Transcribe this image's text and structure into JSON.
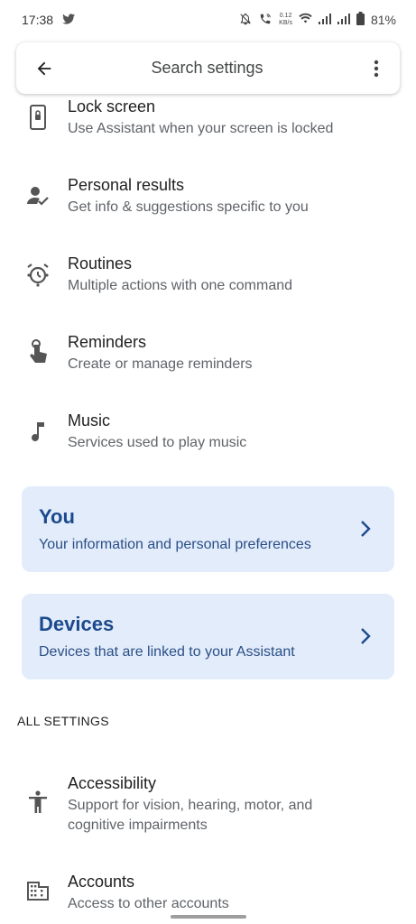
{
  "status_bar": {
    "time": "17:38",
    "net_speed_value": "0.12",
    "net_speed_unit": "KB/s",
    "battery": "81%"
  },
  "search": {
    "placeholder": "Search settings"
  },
  "items": [
    {
      "title": "Lock screen",
      "subtitle": "Use Assistant when your screen is locked"
    },
    {
      "title": "Personal results",
      "subtitle": "Get info & suggestions specific to you"
    },
    {
      "title": "Routines",
      "subtitle": "Multiple actions with one command"
    },
    {
      "title": "Reminders",
      "subtitle": "Create or manage reminders"
    },
    {
      "title": "Music",
      "subtitle": "Services used to play music"
    }
  ],
  "cards": [
    {
      "title": "You",
      "subtitle": "Your information and personal preferences"
    },
    {
      "title": "Devices",
      "subtitle": "Devices that are linked to your Assistant"
    }
  ],
  "all_settings": {
    "header": "ALL SETTINGS",
    "items": [
      {
        "title": "Accessibility",
        "subtitle": "Support for vision, hearing, motor, and cognitive impairments"
      },
      {
        "title": "Accounts",
        "subtitle": "Access to other accounts"
      }
    ]
  },
  "colors": {
    "card_bg": "#e3ecfb",
    "card_title": "#1b4a8c"
  }
}
